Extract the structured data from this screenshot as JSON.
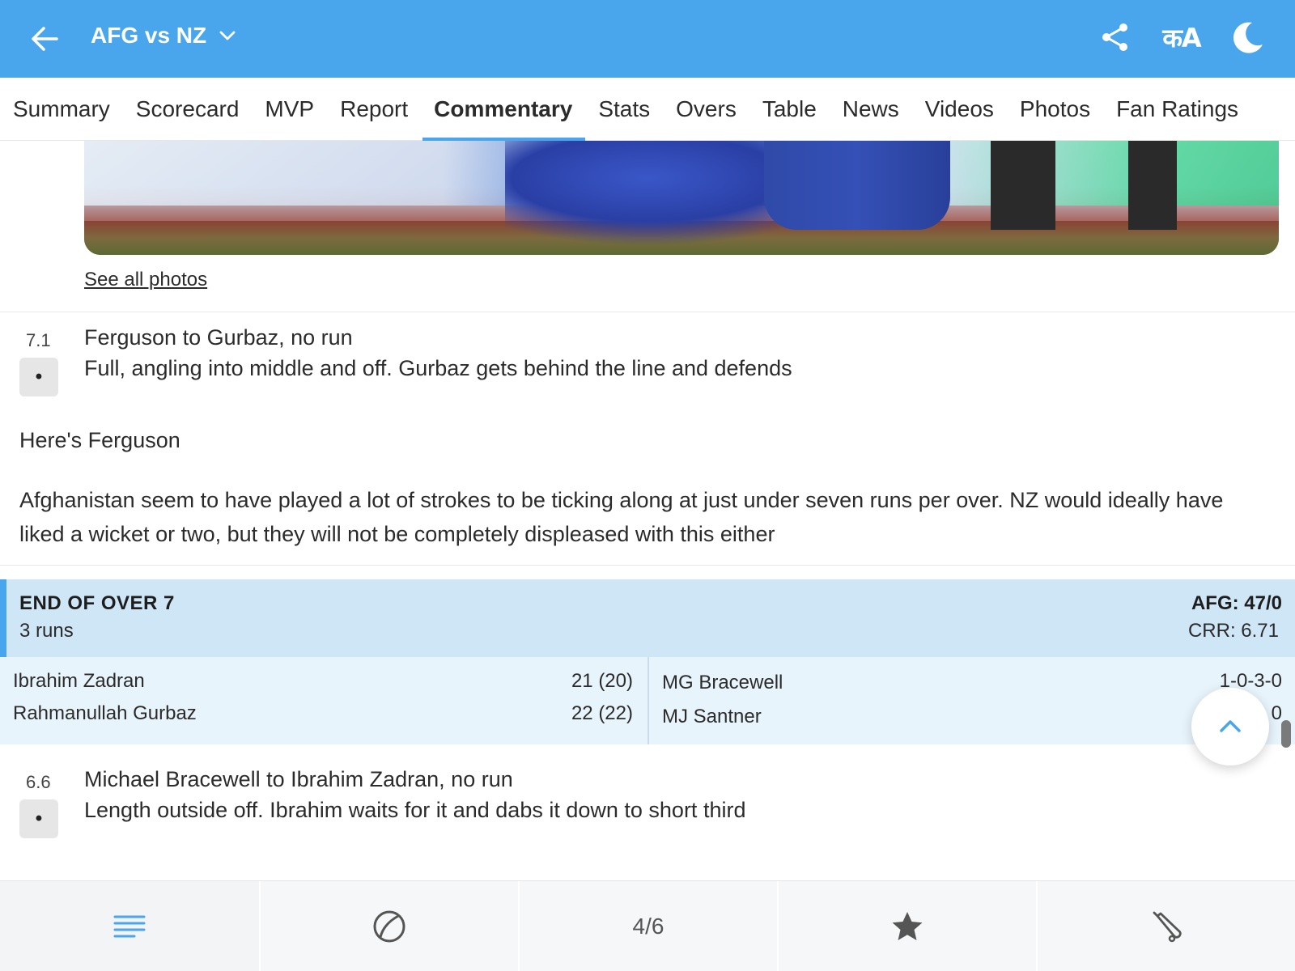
{
  "header": {
    "title": "AFG vs NZ",
    "lang_label": "कA",
    "accent_color": "#4aa6ec"
  },
  "tabs": [
    {
      "label": "Summary"
    },
    {
      "label": "Scorecard"
    },
    {
      "label": "MVP"
    },
    {
      "label": "Report"
    },
    {
      "label": "Commentary",
      "active": true
    },
    {
      "label": "Stats"
    },
    {
      "label": "Overs"
    },
    {
      "label": "Table"
    },
    {
      "label": "News"
    },
    {
      "label": "Videos"
    },
    {
      "label": "Photos"
    },
    {
      "label": "Fan Ratings"
    }
  ],
  "photo": {
    "see_all_label": "See all photos"
  },
  "balls": [
    {
      "over": "7.1",
      "result": "•",
      "headline": "Ferguson to Gurbaz, no run",
      "description": "Full, angling into middle and off. Gurbaz gets behind the line and defends"
    },
    {
      "over": "6.6",
      "result": "•",
      "headline": "Michael Bracewell to Ibrahim Zadran, no run",
      "description": "Length outside off. Ibrahim waits for it and dabs it down to short third"
    }
  ],
  "notes": {
    "p1": "Here's Ferguson",
    "p2": "Afghanistan seem to have played a lot of strokes to be ticking along at just under seven runs per over. NZ would ideally have liked a wicket or two, but they will not be completely displeased with this either"
  },
  "end_of_over": {
    "title": "END OF OVER 7",
    "runs": "3 runs",
    "score": "AFG: 47/0",
    "crr": "CRR: 6.71",
    "batters": [
      {
        "name": "Ibrahim Zadran",
        "score": "21 (20)"
      },
      {
        "name": "Rahmanullah Gurbaz",
        "score": "22 (22)"
      }
    ],
    "bowlers": [
      {
        "name": "MG Bracewell",
        "figures": "1-0-3-0"
      },
      {
        "name": "MJ Santner",
        "figures": "0"
      }
    ]
  },
  "bottom_nav": {
    "page_indicator": "4/6",
    "items": [
      "commentary-icon",
      "ball-icon",
      "page-indicator",
      "star-icon",
      "bat-icon"
    ]
  }
}
